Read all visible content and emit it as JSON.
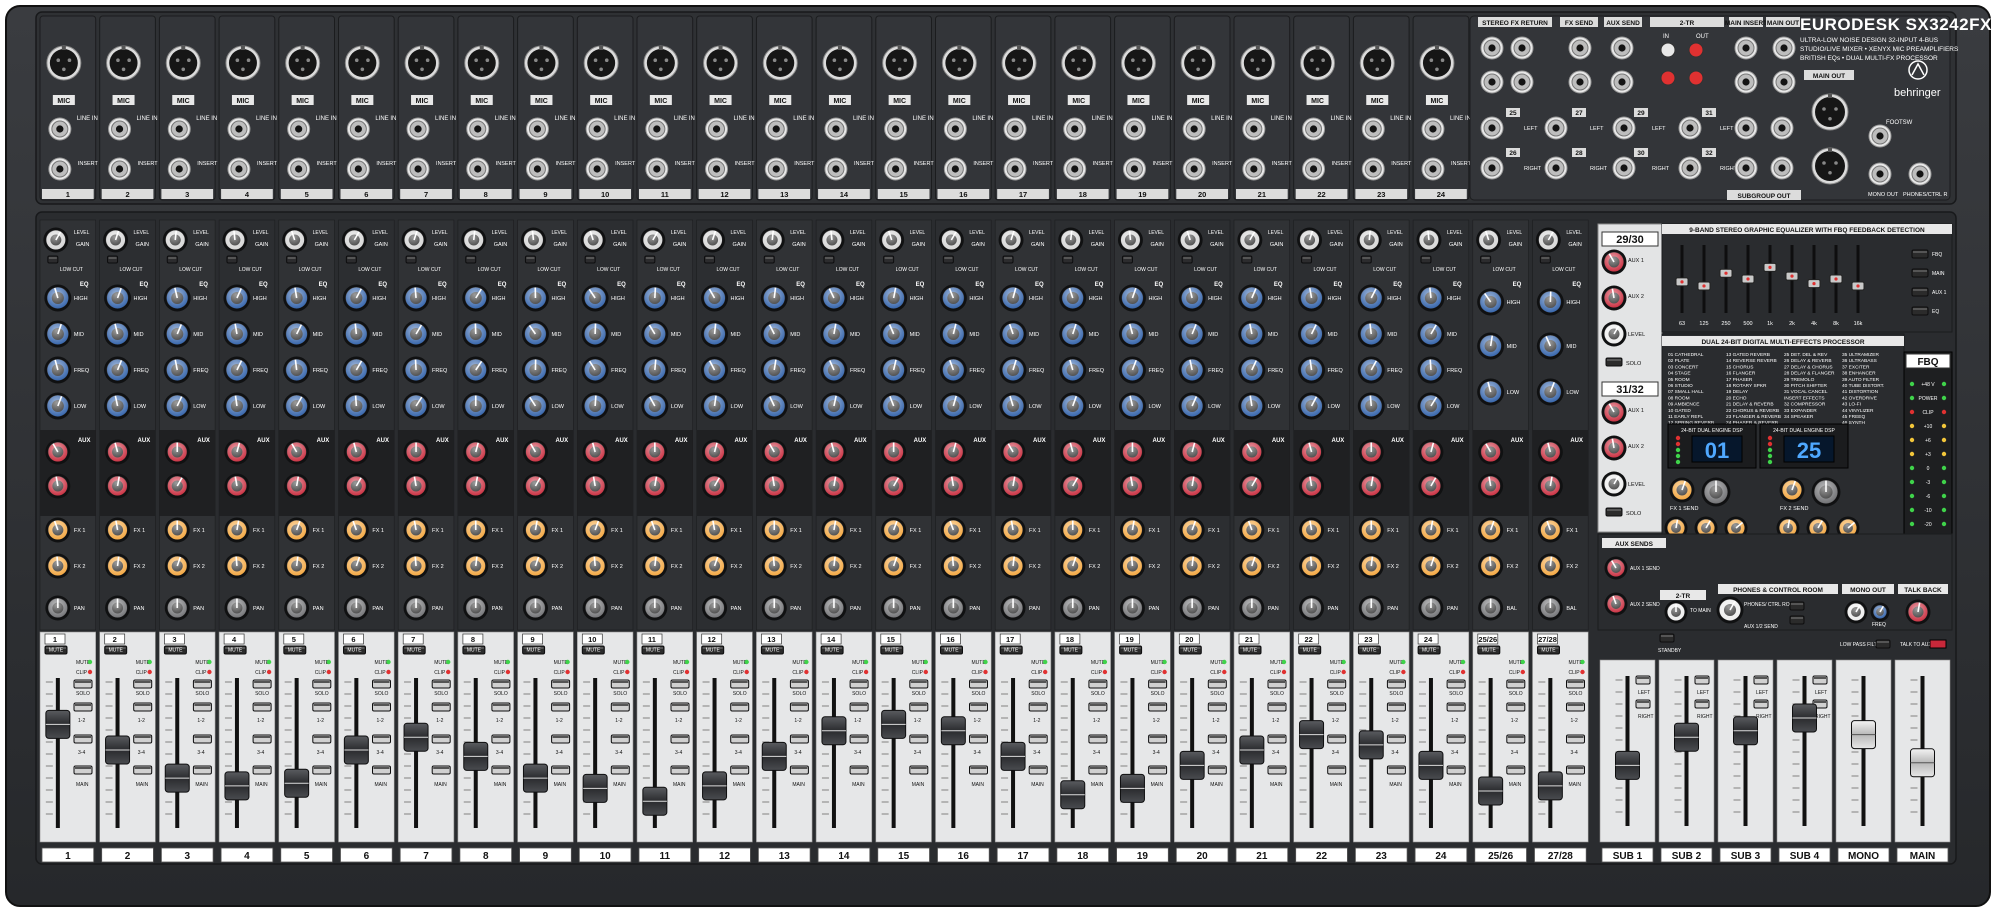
{
  "brand": {
    "product": "EURODESK SX3242FX",
    "tagline_lines": [
      "ULTRA-LOW NOISE DESIGN 32-INPUT 4-BUS",
      "STUDIO/LIVE MIXER • XENYX MIC PREAMPLIFIERS",
      "BRITISH EQs • DUAL MULTI-FX PROCESSOR"
    ],
    "logo": "behringer"
  },
  "colors": {
    "panel": "#2b2d30",
    "panel_dark": "#1d1e20",
    "strip_light": "#e6e7e8",
    "knob_blue": "#2e5fa8",
    "knob_red": "#c8283a",
    "knob_orange": "#f3a43a",
    "knob_gray": "#d4d4d4",
    "led_green": "#3fd34a",
    "led_red": "#e03131",
    "display_blue": "#4fa8ff"
  },
  "mono_channels": [
    "1",
    "2",
    "3",
    "4",
    "5",
    "6",
    "7",
    "8",
    "9",
    "10",
    "11",
    "12",
    "13",
    "14",
    "15",
    "16",
    "17",
    "18",
    "19",
    "20",
    "21",
    "22",
    "23",
    "24"
  ],
  "stereo_channels": [
    "25/26",
    "27/28"
  ],
  "bus_labels": [
    "SUB 1",
    "SUB 2",
    "SUB 3",
    "SUB 4",
    "MONO",
    "MAIN"
  ],
  "jack_labels": {
    "mic": "MIC",
    "line_in": "LINE IN",
    "insert": "INSERT I/O",
    "left": "LEFT",
    "right": "RIGHT"
  },
  "rear_sections": {
    "stereo_fx_return": "STEREO FX RETURN",
    "fx_send": "FX SEND",
    "aux_send": "AUX SEND",
    "two_tr": "2-TR",
    "in": "IN",
    "out": "OUT",
    "main_insert": "MAIN INSERT",
    "main_out": "MAIN OUT",
    "subgroup_out": "SUBGROUP OUT",
    "footsw": "FOOTSW",
    "mono_out": "MONO OUT",
    "phones": "PHONES/CTRL R",
    "stereo_inputs": [
      "25",
      "26",
      "27",
      "28",
      "29",
      "30",
      "31",
      "32"
    ]
  },
  "strip_labels": {
    "level": "LEVEL",
    "gain": "GAIN",
    "low_cut": "LOW CUT",
    "eq": "EQ",
    "high": "HIGH",
    "mid": "MID",
    "freq": "FREQ",
    "low": "LOW",
    "aux": "AUX",
    "fx1": "FX 1",
    "fx2": "FX 2",
    "pan": "PAN",
    "bal": "BAL",
    "mute": "MUTE",
    "clip": "CLIP",
    "solo": "SOLO",
    "a12": "1-2",
    "a34": "3-4",
    "main": "MAIN"
  },
  "returns": {
    "ret1": "29/30",
    "ret2": "31/32",
    "aux1": "AUX 1",
    "aux2": "AUX 2",
    "level": "LEVEL",
    "solo": "SOLO"
  },
  "eq": {
    "title": "9-BAND STEREO GRAPHIC EQUALIZER WITH FBQ FEEDBACK DETECTION",
    "bands": [
      "63",
      "125",
      "250",
      "500",
      "1k",
      "2k",
      "4k",
      "8k",
      "16k"
    ],
    "band_positions": [
      0.55,
      0.62,
      0.4,
      0.5,
      0.3,
      0.45,
      0.58,
      0.5,
      0.62
    ],
    "fbq": "FBQ",
    "buttons": [
      "FBQ",
      "MAIN",
      "AUX 1",
      "EQ"
    ]
  },
  "fx": {
    "title": "DUAL 24-BIT DIGITAL MULTI-EFFECTS PROCESSOR",
    "presets": [
      [
        "01 CATHEDRAL",
        "02 PLATE",
        "03 CONCERT",
        "04 STAGE",
        "05 ROOM",
        "06 STUDIO",
        "07 SMALL HALL",
        "08 ROOM",
        "09 AMBIENCE",
        "10 GATED",
        "11 EARLY REFL",
        "12 SPRING REVERB"
      ],
      [
        "13 GATED REVERB",
        "14 REVERSE REVERB",
        "15 CHORUS",
        "16 FLANGER",
        "17 PHASER",
        "18 ROTARY SPKR",
        "19 DELAY",
        "20 ECHO",
        "21 DELAY & REVERB",
        "22 CHORUS & REVERB",
        "23 FLANGER & REVERB",
        "24 PHASER & REVERB"
      ],
      [
        "25 DET. DEL & REV",
        "26 DELAY & REVERB",
        "27 DELAY & CHORUS",
        "28 DELAY & FLANGER",
        "29 TREMOLO",
        "30 PITCH SHIFTER",
        "31 VOCAL CANCEL",
        "INSERT EFFECTS",
        "32 COMPRESSOR",
        "33 EXPANDER",
        "34 SPEAKER"
      ],
      [
        "35 ULTRAMIZER",
        "36 ULTRABASS",
        "37 EXCITER",
        "38 ENHANCER",
        "39 AUTO FILTER",
        "40 TUBE DISTORT.",
        "41 DISTORTION",
        "42 OVERDRIVE",
        "43 LO-FI",
        "44 VINYLIZER",
        "45 FREEQ",
        "46 SYNTH"
      ]
    ],
    "engine_label": "24-BIT DUAL ENGINE DSP",
    "display1": "01",
    "display2": "25",
    "fx1_send": "FX 1 SEND",
    "fx2_send": "FX 2 SEND",
    "fx1_to": [
      "FX 1 TO AUX 1",
      "FX 1 TO AUX 2",
      "FX 1 TO MAIN"
    ],
    "fx2_to": [
      "FX 2 TO AUX 1",
      "FX 2 TO AUX 2",
      "FX 2 TO MAIN"
    ]
  },
  "meter": {
    "labels": [
      "+48 V",
      "POWER",
      "CLIP",
      "+10",
      "+6",
      "+3",
      "0",
      "-3",
      "-6",
      "-10",
      "-20",
      "-30"
    ],
    "solo": "SOLO",
    "pfl": "PFL LEVEL SET"
  },
  "master": {
    "aux_sends": "AUX SENDS",
    "aux1_send": "AUX 1 SEND",
    "aux2_send": "AUX 2 SEND",
    "two_tr": "2-TR",
    "to_main": "TO MAIN",
    "standby": "STANDBY",
    "phones": "PHONES & CONTROL ROOM",
    "phones_ctrl": "PHONES/ CTRL ROOM",
    "aux12_send": "AUX 1/2 SEND",
    "mono_out": "MONO OUT",
    "freq": "FREQ",
    "low_pass": "LOW PASS FILTER",
    "talk_back": "TALK BACK",
    "talk_to": "TALK TO AUX 1-2",
    "left": "LEFT",
    "right": "RIGHT"
  },
  "channel_positions": {
    "mono": [
      0.3,
      0.5,
      0.72,
      0.78,
      0.76,
      0.5,
      0.4,
      0.55,
      0.72,
      0.8,
      0.9,
      0.78,
      0.55,
      0.35,
      0.3,
      0.35,
      0.55,
      0.85,
      0.8,
      0.62,
      0.5,
      0.38,
      0.46,
      0.62
    ],
    "stereo": [
      0.82,
      0.78
    ],
    "bus": [
      0.62,
      0.4,
      0.35,
      0.25,
      0.38,
      0.6
    ]
  }
}
